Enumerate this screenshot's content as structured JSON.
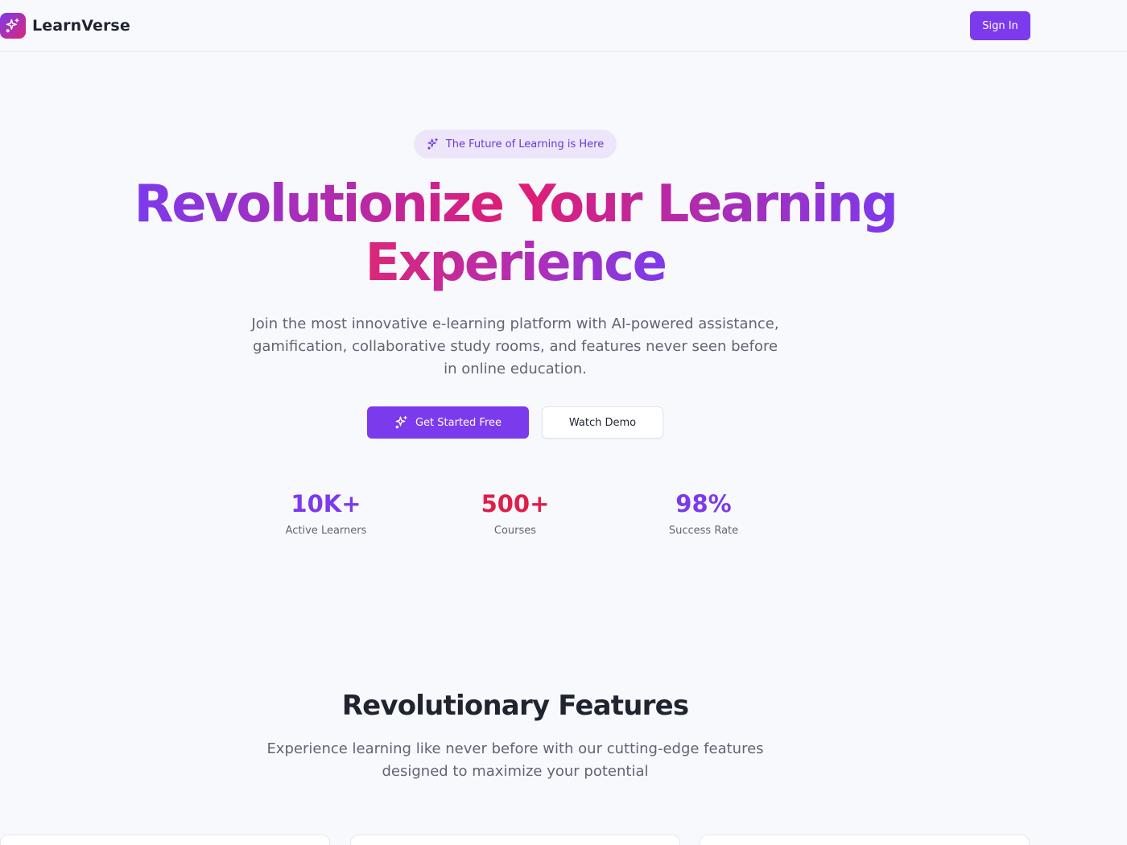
{
  "header": {
    "brand_name": "LearnVerse",
    "signin_label": "Sign In",
    "logo_icon": "sparkles-icon"
  },
  "hero": {
    "badge_text": "The Future of Learning is Here",
    "badge_icon": "sparkles-icon",
    "title_line1_part1": "Revolutionize",
    "title_line1_part2": "Your",
    "title_line1_part3": "Learning",
    "title_line2": "Experience",
    "subtitle": "Join the most innovative e-learning platform with AI-powered assistance, gamification, collaborative study rooms, and features never seen before in online education.",
    "primary_button": "Get Started Free",
    "secondary_button": "Watch Demo"
  },
  "stats": [
    {
      "value": "10K+",
      "label": "Active Learners",
      "color": "#7c3aed"
    },
    {
      "value": "500+",
      "label": "Courses",
      "color": "#e11d48"
    },
    {
      "value": "98%",
      "label": "Success Rate",
      "color": "#7c3aed"
    }
  ],
  "features": {
    "title": "Revolutionary Features",
    "subtitle": "Experience learning like never before with our cutting-edge features designed to maximize your potential"
  },
  "colors": {
    "primary": "#7c3aed",
    "accent": "#db2777",
    "background": "#f8f9fc"
  }
}
